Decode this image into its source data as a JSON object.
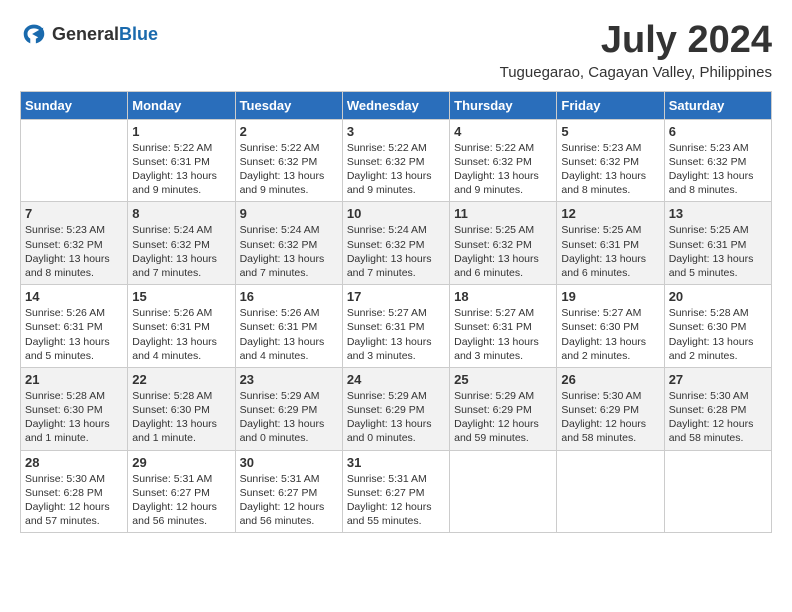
{
  "header": {
    "logo_general": "General",
    "logo_blue": "Blue",
    "month_year": "July 2024",
    "location": "Tuguegarao, Cagayan Valley, Philippines"
  },
  "weekdays": [
    "Sunday",
    "Monday",
    "Tuesday",
    "Wednesday",
    "Thursday",
    "Friday",
    "Saturday"
  ],
  "weeks": [
    [
      {
        "day": "",
        "info": ""
      },
      {
        "day": "1",
        "info": "Sunrise: 5:22 AM\nSunset: 6:31 PM\nDaylight: 13 hours\nand 9 minutes."
      },
      {
        "day": "2",
        "info": "Sunrise: 5:22 AM\nSunset: 6:32 PM\nDaylight: 13 hours\nand 9 minutes."
      },
      {
        "day": "3",
        "info": "Sunrise: 5:22 AM\nSunset: 6:32 PM\nDaylight: 13 hours\nand 9 minutes."
      },
      {
        "day": "4",
        "info": "Sunrise: 5:22 AM\nSunset: 6:32 PM\nDaylight: 13 hours\nand 9 minutes."
      },
      {
        "day": "5",
        "info": "Sunrise: 5:23 AM\nSunset: 6:32 PM\nDaylight: 13 hours\nand 8 minutes."
      },
      {
        "day": "6",
        "info": "Sunrise: 5:23 AM\nSunset: 6:32 PM\nDaylight: 13 hours\nand 8 minutes."
      }
    ],
    [
      {
        "day": "7",
        "info": "Sunrise: 5:23 AM\nSunset: 6:32 PM\nDaylight: 13 hours\nand 8 minutes."
      },
      {
        "day": "8",
        "info": "Sunrise: 5:24 AM\nSunset: 6:32 PM\nDaylight: 13 hours\nand 7 minutes."
      },
      {
        "day": "9",
        "info": "Sunrise: 5:24 AM\nSunset: 6:32 PM\nDaylight: 13 hours\nand 7 minutes."
      },
      {
        "day": "10",
        "info": "Sunrise: 5:24 AM\nSunset: 6:32 PM\nDaylight: 13 hours\nand 7 minutes."
      },
      {
        "day": "11",
        "info": "Sunrise: 5:25 AM\nSunset: 6:32 PM\nDaylight: 13 hours\nand 6 minutes."
      },
      {
        "day": "12",
        "info": "Sunrise: 5:25 AM\nSunset: 6:31 PM\nDaylight: 13 hours\nand 6 minutes."
      },
      {
        "day": "13",
        "info": "Sunrise: 5:25 AM\nSunset: 6:31 PM\nDaylight: 13 hours\nand 5 minutes."
      }
    ],
    [
      {
        "day": "14",
        "info": "Sunrise: 5:26 AM\nSunset: 6:31 PM\nDaylight: 13 hours\nand 5 minutes."
      },
      {
        "day": "15",
        "info": "Sunrise: 5:26 AM\nSunset: 6:31 PM\nDaylight: 13 hours\nand 4 minutes."
      },
      {
        "day": "16",
        "info": "Sunrise: 5:26 AM\nSunset: 6:31 PM\nDaylight: 13 hours\nand 4 minutes."
      },
      {
        "day": "17",
        "info": "Sunrise: 5:27 AM\nSunset: 6:31 PM\nDaylight: 13 hours\nand 3 minutes."
      },
      {
        "day": "18",
        "info": "Sunrise: 5:27 AM\nSunset: 6:31 PM\nDaylight: 13 hours\nand 3 minutes."
      },
      {
        "day": "19",
        "info": "Sunrise: 5:27 AM\nSunset: 6:30 PM\nDaylight: 13 hours\nand 2 minutes."
      },
      {
        "day": "20",
        "info": "Sunrise: 5:28 AM\nSunset: 6:30 PM\nDaylight: 13 hours\nand 2 minutes."
      }
    ],
    [
      {
        "day": "21",
        "info": "Sunrise: 5:28 AM\nSunset: 6:30 PM\nDaylight: 13 hours\nand 1 minute."
      },
      {
        "day": "22",
        "info": "Sunrise: 5:28 AM\nSunset: 6:30 PM\nDaylight: 13 hours\nand 1 minute."
      },
      {
        "day": "23",
        "info": "Sunrise: 5:29 AM\nSunset: 6:29 PM\nDaylight: 13 hours\nand 0 minutes."
      },
      {
        "day": "24",
        "info": "Sunrise: 5:29 AM\nSunset: 6:29 PM\nDaylight: 13 hours\nand 0 minutes."
      },
      {
        "day": "25",
        "info": "Sunrise: 5:29 AM\nSunset: 6:29 PM\nDaylight: 12 hours\nand 59 minutes."
      },
      {
        "day": "26",
        "info": "Sunrise: 5:30 AM\nSunset: 6:29 PM\nDaylight: 12 hours\nand 58 minutes."
      },
      {
        "day": "27",
        "info": "Sunrise: 5:30 AM\nSunset: 6:28 PM\nDaylight: 12 hours\nand 58 minutes."
      }
    ],
    [
      {
        "day": "28",
        "info": "Sunrise: 5:30 AM\nSunset: 6:28 PM\nDaylight: 12 hours\nand 57 minutes."
      },
      {
        "day": "29",
        "info": "Sunrise: 5:31 AM\nSunset: 6:27 PM\nDaylight: 12 hours\nand 56 minutes."
      },
      {
        "day": "30",
        "info": "Sunrise: 5:31 AM\nSunset: 6:27 PM\nDaylight: 12 hours\nand 56 minutes."
      },
      {
        "day": "31",
        "info": "Sunrise: 5:31 AM\nSunset: 6:27 PM\nDaylight: 12 hours\nand 55 minutes."
      },
      {
        "day": "",
        "info": ""
      },
      {
        "day": "",
        "info": ""
      },
      {
        "day": "",
        "info": ""
      }
    ]
  ]
}
